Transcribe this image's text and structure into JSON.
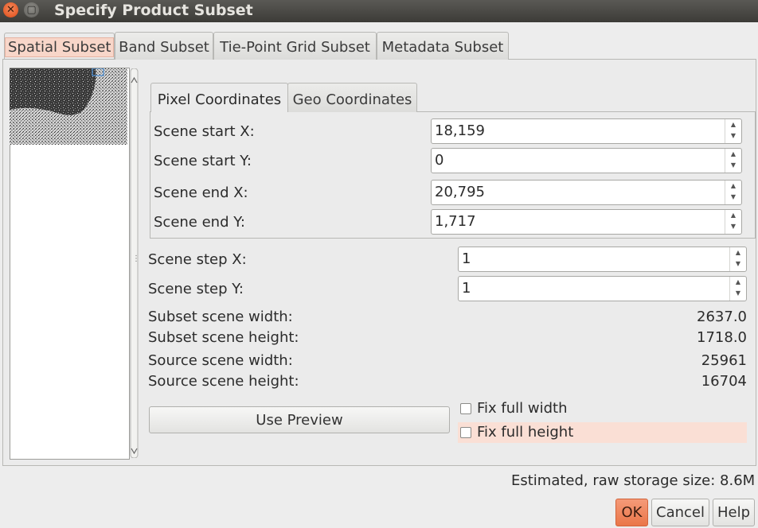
{
  "window": {
    "title": "Specify Product Subset"
  },
  "tabs": [
    "Spatial Subset",
    "Band Subset",
    "Tie-Point Grid Subset",
    "Metadata Subset"
  ],
  "inner_tabs": [
    "Pixel Coordinates",
    "Geo Coordinates"
  ],
  "fields": [
    {
      "label": "Scene start X:",
      "value": "18,159"
    },
    {
      "label": "Scene start Y:",
      "value": "0"
    },
    {
      "label": "Scene end X:",
      "value": "20,795"
    },
    {
      "label": "Scene end Y:",
      "value": "1,717"
    }
  ],
  "steps": [
    {
      "label": "Scene step X:",
      "value": "1"
    },
    {
      "label": "Scene step Y:",
      "value": "1"
    }
  ],
  "info": [
    {
      "label": "Subset scene width:",
      "value": "2637.0"
    },
    {
      "label": "Subset scene height:",
      "value": "1718.0"
    },
    {
      "label": "Source scene width:",
      "value": "25961"
    },
    {
      "label": "Source scene height:",
      "value": "16704"
    }
  ],
  "use_preview": "Use Preview",
  "fix_width": "Fix full width",
  "fix_height": "Fix full height",
  "storage": "Estimated, raw storage size: 8.6M",
  "buttons": {
    "ok": "OK",
    "cancel": "Cancel",
    "help": "Help"
  },
  "colors": {
    "accent": "#ea7649",
    "highlight": "#fadfd5",
    "titlebar": "#3c3b37"
  },
  "icons": {
    "close": "close-icon",
    "maximize": "maximize-icon",
    "spin": "spin-arrows-icon"
  }
}
